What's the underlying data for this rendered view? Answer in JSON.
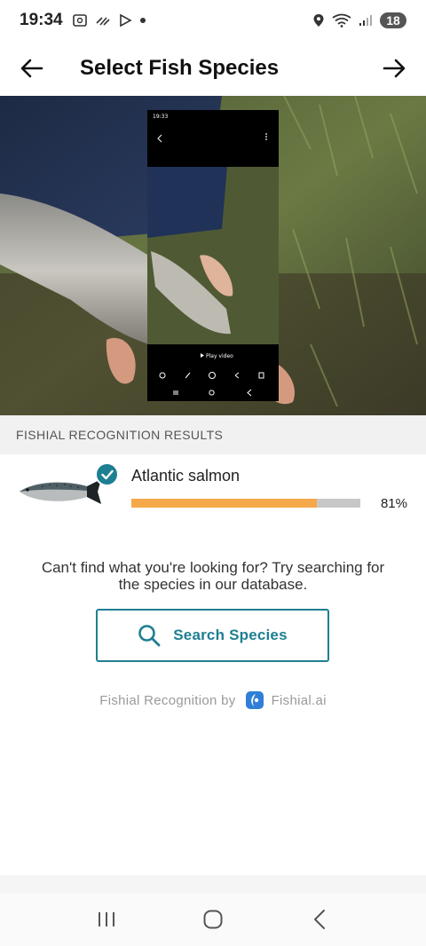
{
  "status_bar": {
    "time": "19:34",
    "battery": "18"
  },
  "header": {
    "title": "Select Fish Species"
  },
  "results": {
    "section_title": "FISHIAL RECOGNITION RESULTS",
    "items": [
      {
        "name": "Atlantic salmon",
        "confidence_label": "81%",
        "confidence": 0.81
      }
    ]
  },
  "helper_text": "Can't find what you're looking for? Try searching for the species in our database.",
  "search_button": {
    "label": "Search Species"
  },
  "attribution": {
    "prefix": "Fishial Recognition by",
    "brand": "Fishial.ai"
  },
  "embedded_screenshot": {
    "time": "19:33",
    "play_label": "Play video"
  },
  "colors": {
    "accent": "#1e7f92",
    "bar_fill": "#f5a94a",
    "bar_track": "#c7c7c7"
  },
  "icons": [
    "back-arrow-icon",
    "forward-arrow-icon",
    "check-icon",
    "search-icon",
    "fishial-logo-icon",
    "nav-recents-icon",
    "nav-home-icon",
    "nav-back-icon"
  ]
}
